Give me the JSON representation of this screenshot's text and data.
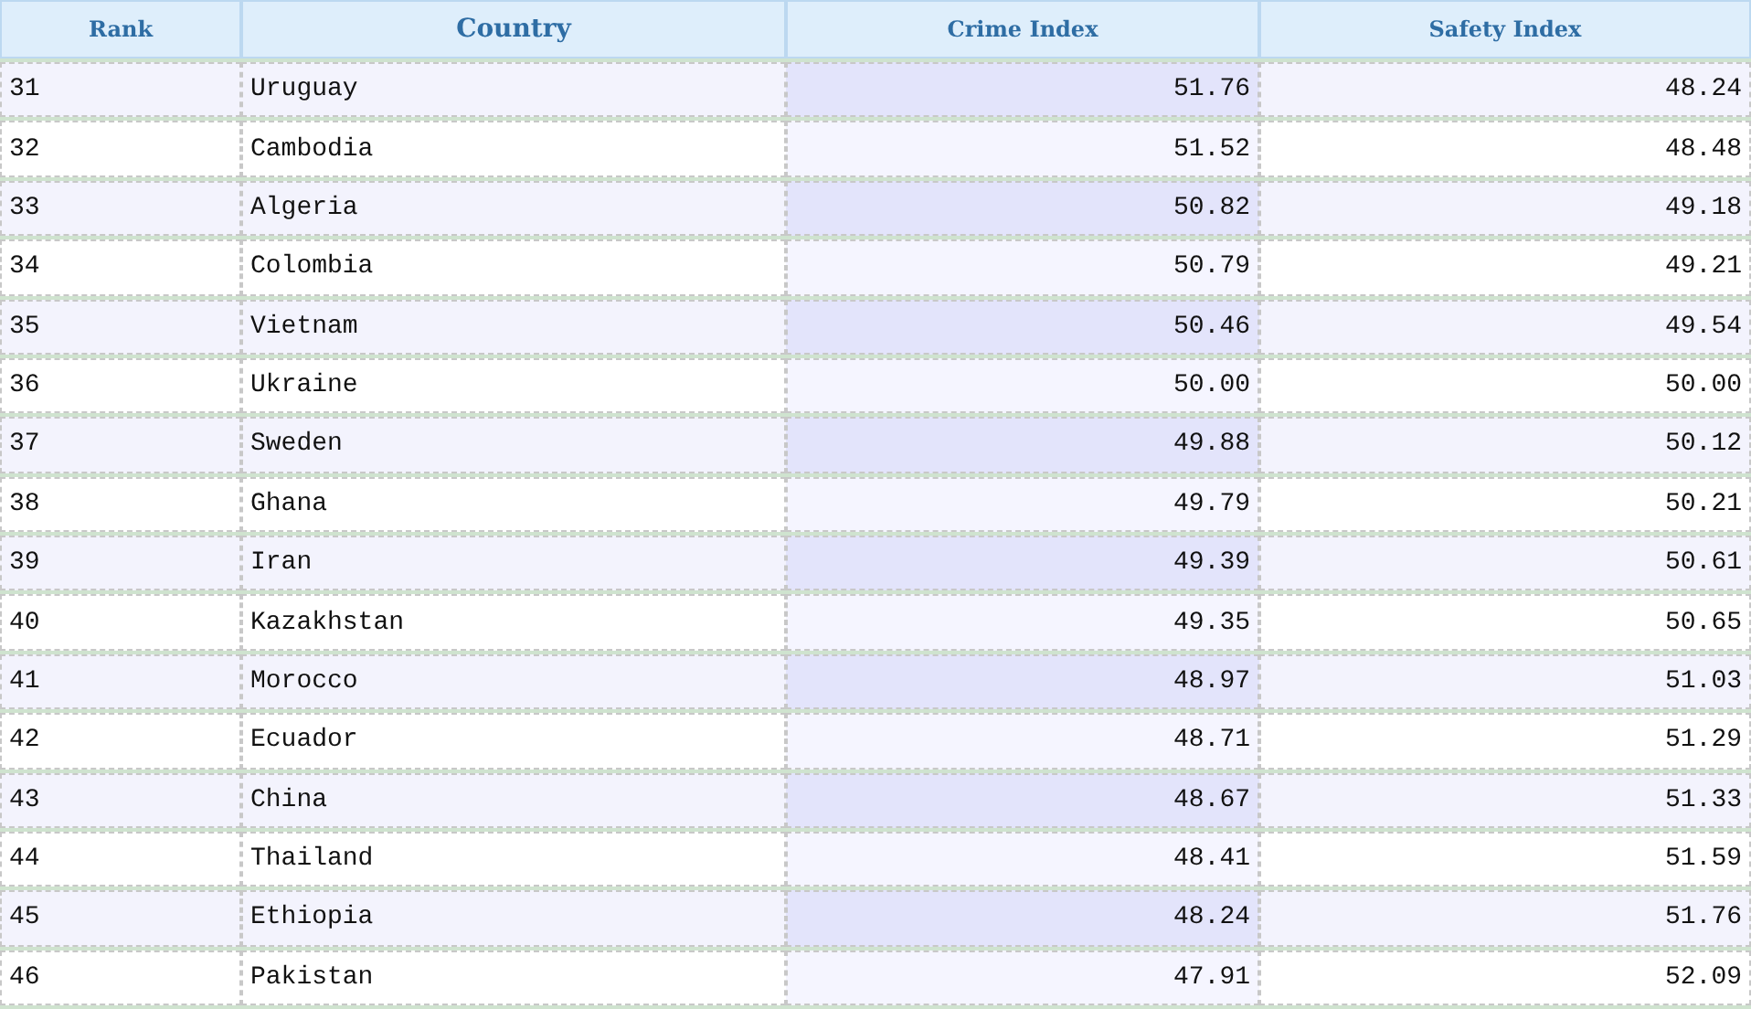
{
  "table": {
    "columns": [
      "Rank",
      "Country",
      "Crime Index",
      "Safety Index"
    ],
    "rows": [
      {
        "rank": "31",
        "country": "Uruguay",
        "crime_index": "51.76",
        "safety_index": "48.24"
      },
      {
        "rank": "32",
        "country": "Cambodia",
        "crime_index": "51.52",
        "safety_index": "48.48"
      },
      {
        "rank": "33",
        "country": "Algeria",
        "crime_index": "50.82",
        "safety_index": "49.18"
      },
      {
        "rank": "34",
        "country": "Colombia",
        "crime_index": "50.79",
        "safety_index": "49.21"
      },
      {
        "rank": "35",
        "country": "Vietnam",
        "crime_index": "50.46",
        "safety_index": "49.54"
      },
      {
        "rank": "36",
        "country": "Ukraine",
        "crime_index": "50.00",
        "safety_index": "50.00"
      },
      {
        "rank": "37",
        "country": "Sweden",
        "crime_index": "49.88",
        "safety_index": "50.12"
      },
      {
        "rank": "38",
        "country": "Ghana",
        "crime_index": "49.79",
        "safety_index": "50.21"
      },
      {
        "rank": "39",
        "country": "Iran",
        "crime_index": "49.39",
        "safety_index": "50.61"
      },
      {
        "rank": "40",
        "country": "Kazakhstan",
        "crime_index": "49.35",
        "safety_index": "50.65"
      },
      {
        "rank": "41",
        "country": "Morocco",
        "crime_index": "48.97",
        "safety_index": "51.03"
      },
      {
        "rank": "42",
        "country": "Ecuador",
        "crime_index": "48.71",
        "safety_index": "51.29"
      },
      {
        "rank": "43",
        "country": "China",
        "crime_index": "48.67",
        "safety_index": "51.33"
      },
      {
        "rank": "44",
        "country": "Thailand",
        "crime_index": "48.41",
        "safety_index": "51.59"
      },
      {
        "rank": "45",
        "country": "Ethiopia",
        "crime_index": "48.24",
        "safety_index": "51.76"
      },
      {
        "rank": "46",
        "country": "Pakistan",
        "crime_index": "47.91",
        "safety_index": "52.09"
      }
    ]
  }
}
